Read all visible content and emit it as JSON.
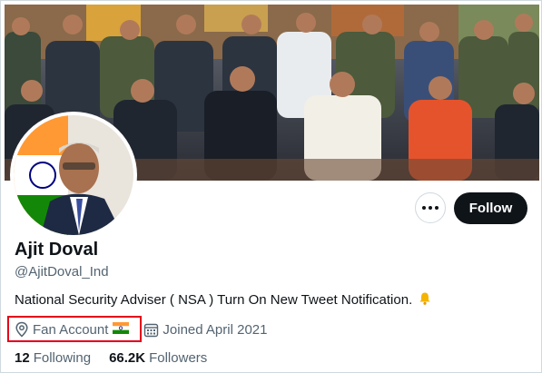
{
  "profile": {
    "name": "Ajit Doval",
    "handle": "@AjitDoval_Ind",
    "bio": "National Security Adviser ( NSA ) Turn On New Tweet Notification.",
    "location": "Fan Account",
    "joined": "Joined April 2021"
  },
  "stats": {
    "following_count": "12",
    "following_label": "Following",
    "followers_count": "66.2K",
    "followers_label": "Followers"
  },
  "actions": {
    "follow_label": "Follow",
    "more_icon": "more-horizontal-icon"
  },
  "icons": {
    "location": "location-pin-icon",
    "calendar": "calendar-icon",
    "bell": "bell-icon",
    "flag": "india-flag-icon"
  },
  "colors": {
    "primary_text": "#0f1419",
    "secondary_text": "#536471",
    "follow_button": "#0f1419",
    "highlight": "#e3001b",
    "bell": "#f4b400"
  }
}
